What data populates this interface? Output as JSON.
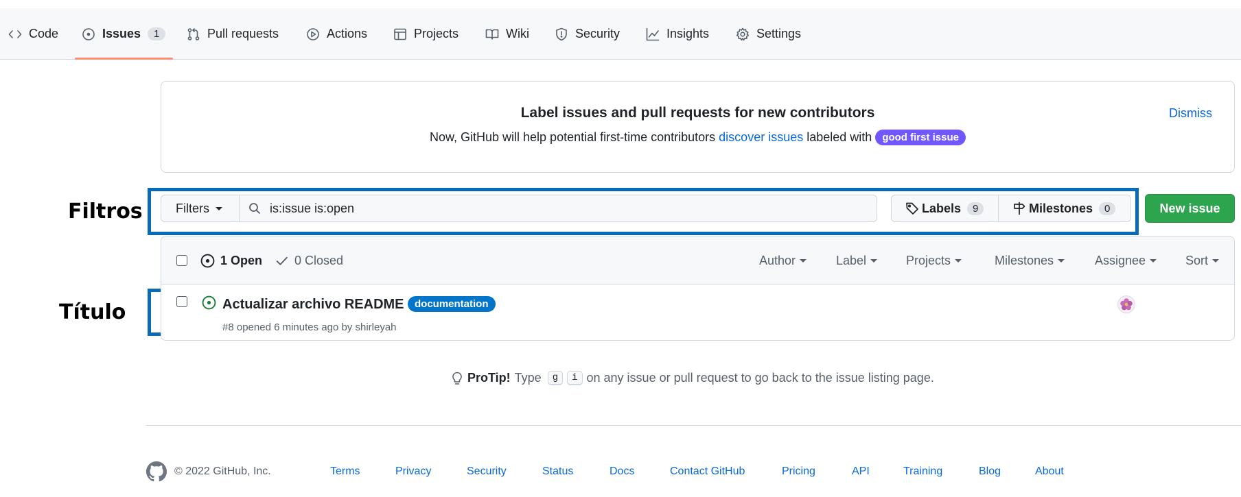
{
  "nav": {
    "tabs": [
      {
        "label": "Code",
        "icon": "code-icon"
      },
      {
        "label": "Issues",
        "icon": "issue-opened-icon",
        "count": "1",
        "selected": true
      },
      {
        "label": "Pull requests",
        "icon": "git-pull-request-icon"
      },
      {
        "label": "Actions",
        "icon": "play-icon"
      },
      {
        "label": "Projects",
        "icon": "table-icon"
      },
      {
        "label": "Wiki",
        "icon": "book-icon"
      },
      {
        "label": "Security",
        "icon": "shield-icon"
      },
      {
        "label": "Insights",
        "icon": "graph-icon"
      },
      {
        "label": "Settings",
        "icon": "gear-icon"
      }
    ],
    "selected_color": "#fd8c73"
  },
  "banner": {
    "title": "Label issues and pull requests for new contributors",
    "text_before": "Now, GitHub will help potential first-time contributors",
    "link": "discover issues",
    "text_after": "labeled with",
    "label": "good first issue",
    "label_color": "#7057ff",
    "dismiss": "Dismiss"
  },
  "annotations": {
    "filters": "Filtros",
    "title": "Título",
    "box_color": "#0a6ab3"
  },
  "filterbar": {
    "filters_label": "Filters",
    "search_value": "is:issue is:open",
    "labels_label": "Labels",
    "labels_count": "9",
    "milestones_label": "Milestones",
    "milestones_count": "0",
    "new_issue": "New issue",
    "new_issue_color": "#2da44e"
  },
  "issues": {
    "open_label": "1 Open",
    "closed_label": "0 Closed",
    "header_filters": [
      "Author",
      "Label",
      "Projects",
      "Milestones",
      "Assignee",
      "Sort"
    ],
    "rows": [
      {
        "title": "Actualizar archivo README",
        "label": "documentation",
        "label_color": "#0075ca",
        "meta_prefix": "#8 opened 6 minutes ago by",
        "author": "shirleyah"
      }
    ]
  },
  "protip": {
    "title": "ProTip!",
    "before": "Type",
    "key1": "g",
    "key2": "i",
    "after": "on any issue or pull request to go back to the issue listing page."
  },
  "footer": {
    "copyright": "© 2022 GitHub, Inc.",
    "links": [
      "Terms",
      "Privacy",
      "Security",
      "Status",
      "Docs",
      "Contact GitHub",
      "Pricing",
      "API",
      "Training",
      "Blog",
      "About"
    ]
  }
}
